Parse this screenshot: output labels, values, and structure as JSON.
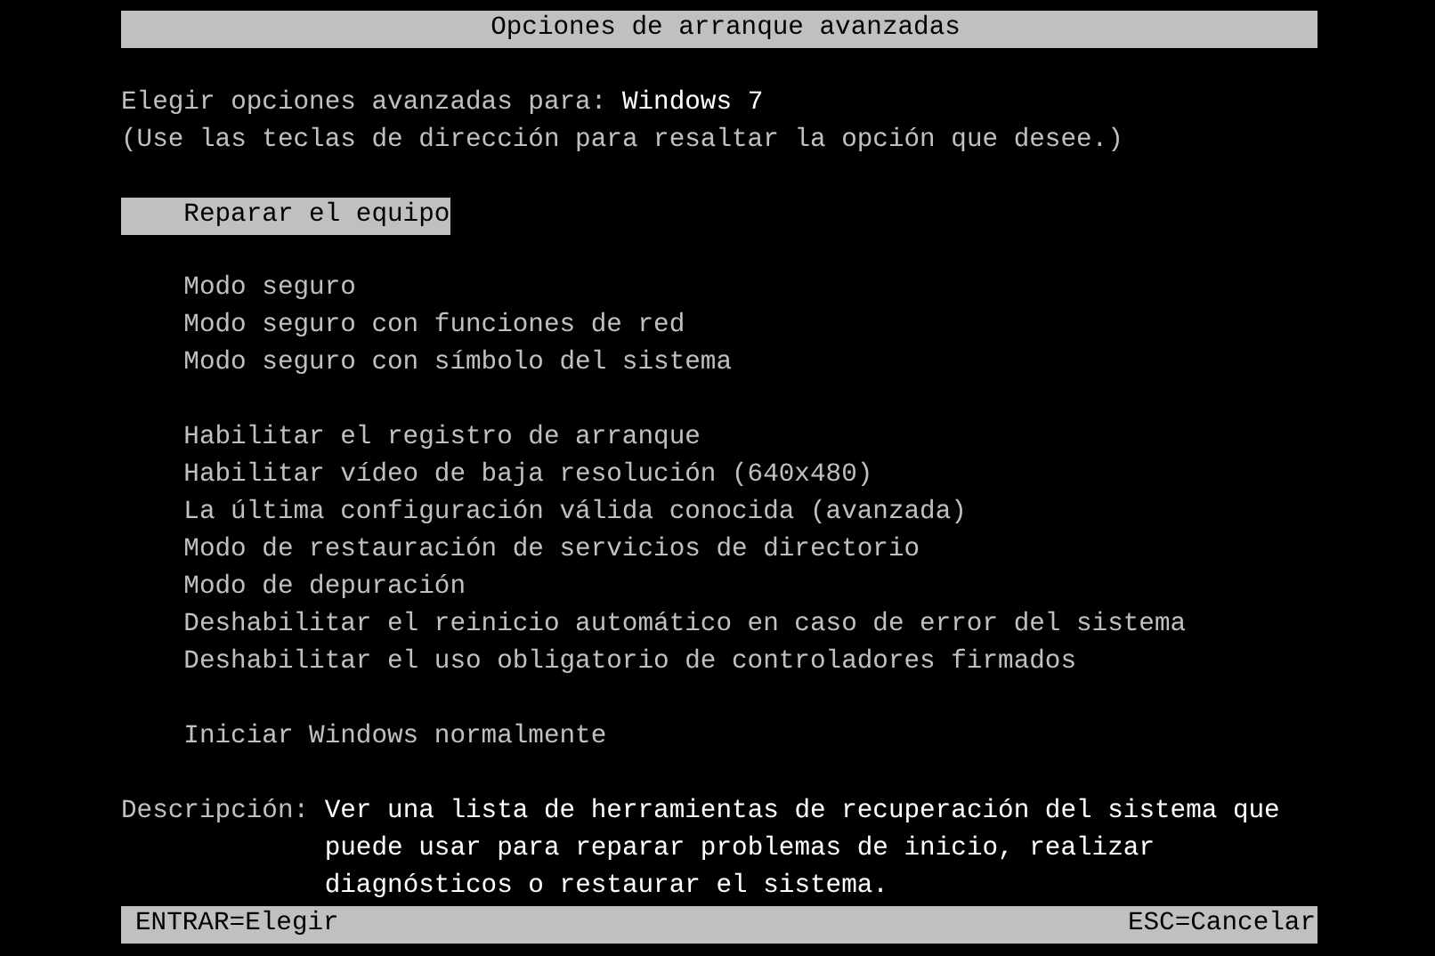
{
  "title": "Opciones de arranque avanzadas",
  "prompt": {
    "label": "Elegir opciones avanzadas para:",
    "os": "Windows 7"
  },
  "hint": "(Use las teclas de dirección para resaltar la opción que desee.)",
  "option_groups": [
    {
      "items": [
        {
          "label": "Reparar el equipo",
          "selected": true
        }
      ]
    },
    {
      "items": [
        {
          "label": "Modo seguro",
          "selected": false
        },
        {
          "label": "Modo seguro con funciones de red",
          "selected": false
        },
        {
          "label": "Modo seguro con símbolo del sistema",
          "selected": false
        }
      ]
    },
    {
      "items": [
        {
          "label": "Habilitar el registro de arranque",
          "selected": false
        },
        {
          "label": "Habilitar vídeo de baja resolución (640x480)",
          "selected": false
        },
        {
          "label": "La última configuración válida conocida (avanzada)",
          "selected": false
        },
        {
          "label": "Modo de restauración de servicios de directorio",
          "selected": false
        },
        {
          "label": "Modo de depuración",
          "selected": false
        },
        {
          "label": "Deshabilitar el reinicio automático en caso de error del sistema",
          "selected": false
        },
        {
          "label": "Deshabilitar el uso obligatorio de controladores firmados",
          "selected": false
        }
      ]
    },
    {
      "items": [
        {
          "label": "Iniciar Windows normalmente",
          "selected": false
        }
      ]
    }
  ],
  "description": {
    "label": "Descripción:",
    "text": "Ver una lista de herramientas de recuperación del sistema que puede usar para reparar problemas de inicio, realizar diagnósticos o restaurar el sistema."
  },
  "status_bar": {
    "left": "ENTRAR=Elegir",
    "right": "ESC=Cancelar"
  }
}
